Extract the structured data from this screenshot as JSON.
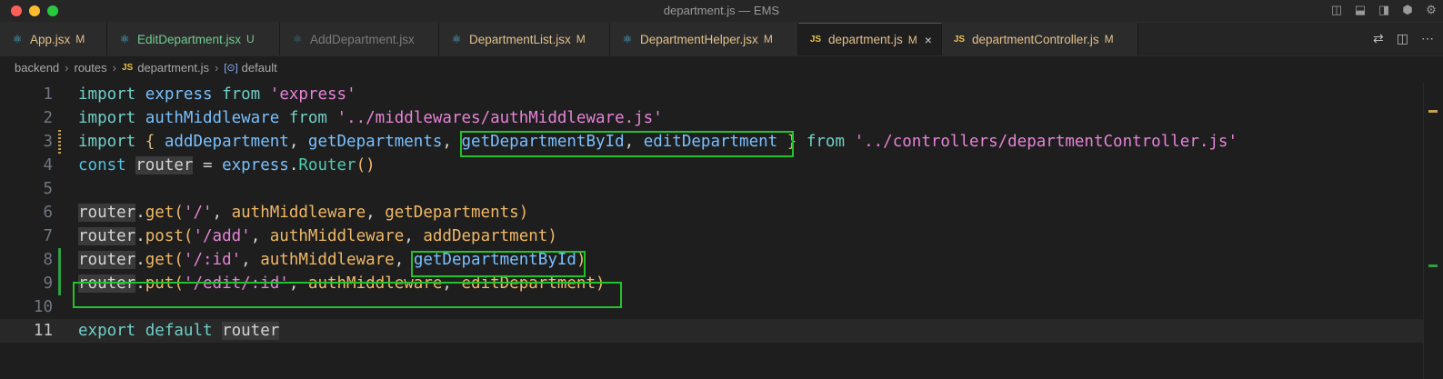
{
  "window": {
    "title": "department.js — EMS"
  },
  "tabs": [
    {
      "label": "App.jsx",
      "badge": "M",
      "icon": "react-icon",
      "state": "modified"
    },
    {
      "label": "EditDepartment.jsx",
      "badge": "U",
      "icon": "react-icon",
      "state": "untracked"
    },
    {
      "label": "AddDepartment.jsx",
      "badge": "",
      "icon": "react-icon",
      "state": "dim"
    },
    {
      "label": "DepartmentList.jsx",
      "badge": "M",
      "icon": "react-icon",
      "state": "modified"
    },
    {
      "label": "DepartmentHelper.jsx",
      "badge": "M",
      "icon": "react-icon",
      "state": "modified"
    },
    {
      "label": "department.js",
      "badge": "M",
      "icon": "js-icon",
      "state": "active",
      "close": "×"
    },
    {
      "label": "departmentController.js",
      "badge": "M",
      "icon": "js-icon",
      "state": "modified"
    }
  ],
  "icons": {
    "js_label": "JS",
    "symbol_label": "[⊙]"
  },
  "breadcrumb": {
    "items": [
      "backend",
      "routes",
      "department.js",
      "default"
    ]
  },
  "editor": {
    "current_line": 11,
    "lines": [
      {
        "n": "1",
        "tokens": [
          [
            "kw",
            "import"
          ],
          [
            "punc",
            " "
          ],
          [
            "id",
            "express"
          ],
          [
            "punc",
            " "
          ],
          [
            "kw",
            "from"
          ],
          [
            "punc",
            " "
          ],
          [
            "str",
            "'express'"
          ]
        ]
      },
      {
        "n": "2",
        "tokens": [
          [
            "kw",
            "import"
          ],
          [
            "punc",
            " "
          ],
          [
            "id",
            "authMiddleware"
          ],
          [
            "punc",
            " "
          ],
          [
            "kw",
            "from"
          ],
          [
            "punc",
            " "
          ],
          [
            "str",
            "'../middlewares/authMiddleware.js'"
          ]
        ]
      },
      {
        "n": "3",
        "tokens": [
          [
            "kw",
            "import"
          ],
          [
            "punc",
            " "
          ],
          [
            "brace",
            "{"
          ],
          [
            "punc",
            " "
          ],
          [
            "id",
            "addDepartment"
          ],
          [
            "punc",
            ", "
          ],
          [
            "id",
            "getDepartments"
          ],
          [
            "punc",
            ", "
          ],
          [
            "id",
            "getDepartmentById"
          ],
          [
            "punc",
            ", "
          ],
          [
            "id",
            "editDepartment"
          ],
          [
            "punc",
            " "
          ],
          [
            "brace",
            "}"
          ],
          [
            "punc",
            " "
          ],
          [
            "kw",
            "from"
          ],
          [
            "punc",
            " "
          ],
          [
            "str",
            "'../controllers/departmentController.js'"
          ]
        ]
      },
      {
        "n": "4",
        "tokens": [
          [
            "kw2",
            "const"
          ],
          [
            "punc",
            " "
          ],
          [
            "hl",
            "router"
          ],
          [
            "punc",
            " = "
          ],
          [
            "id",
            "express"
          ],
          [
            "punc",
            "."
          ],
          [
            "fn",
            "Router"
          ],
          [
            "paren",
            "()"
          ]
        ]
      },
      {
        "n": "5",
        "tokens": []
      },
      {
        "n": "6",
        "tokens": [
          [
            "hl",
            "router"
          ],
          [
            "punc",
            "."
          ],
          [
            "fnc",
            "get"
          ],
          [
            "paren",
            "("
          ],
          [
            "str",
            "'/'"
          ],
          [
            "punc",
            ", "
          ],
          [
            "fnc",
            "authMiddleware"
          ],
          [
            "punc",
            ", "
          ],
          [
            "fnc",
            "getDepartments"
          ],
          [
            "paren",
            ")"
          ]
        ]
      },
      {
        "n": "7",
        "tokens": [
          [
            "hl",
            "router"
          ],
          [
            "punc",
            "."
          ],
          [
            "fnc",
            "post"
          ],
          [
            "paren",
            "("
          ],
          [
            "str",
            "'/add'"
          ],
          [
            "punc",
            ", "
          ],
          [
            "fnc",
            "authMiddleware"
          ],
          [
            "punc",
            ", "
          ],
          [
            "fnc",
            "addDepartment"
          ],
          [
            "paren",
            ")"
          ]
        ]
      },
      {
        "n": "8",
        "tokens": [
          [
            "hl",
            "router"
          ],
          [
            "punc",
            "."
          ],
          [
            "fnc",
            "get"
          ],
          [
            "paren",
            "("
          ],
          [
            "str",
            "'/:id'"
          ],
          [
            "punc",
            ", "
          ],
          [
            "fnc",
            "authMiddleware"
          ],
          [
            "punc",
            ", "
          ],
          [
            "id",
            "getDepartmentById"
          ],
          [
            "paren",
            ")"
          ]
        ]
      },
      {
        "n": "9",
        "tokens": [
          [
            "hl",
            "router"
          ],
          [
            "punc",
            "."
          ],
          [
            "fnc",
            "put"
          ],
          [
            "paren",
            "("
          ],
          [
            "str",
            "'/edit/:id'"
          ],
          [
            "punc",
            ", "
          ],
          [
            "fnc",
            "authMiddleware"
          ],
          [
            "punc",
            ", "
          ],
          [
            "fnc",
            "editDepartment"
          ],
          [
            "paren",
            ")"
          ]
        ]
      },
      {
        "n": "10",
        "tokens": []
      },
      {
        "n": "11",
        "tokens": [
          [
            "kw",
            "export"
          ],
          [
            "punc",
            " "
          ],
          [
            "kw",
            "default"
          ],
          [
            "punc",
            " "
          ],
          [
            "hl",
            "router"
          ]
        ]
      }
    ]
  },
  "colors": {
    "highlight_box": "#22c22c",
    "modified": "#e2c08d",
    "untracked": "#73c991"
  }
}
